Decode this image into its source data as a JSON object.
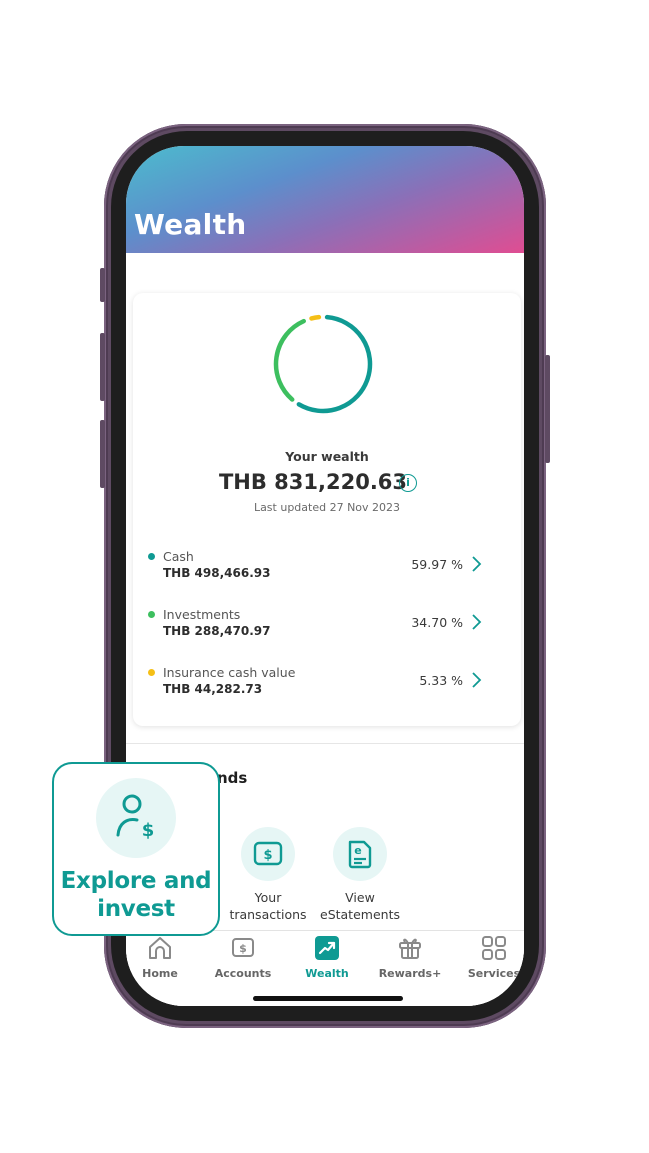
{
  "header": {
    "title": "Wealth"
  },
  "wealth": {
    "label": "Your wealth",
    "total": "THB 831,220.63",
    "info_icon": "info-icon",
    "last_updated": "Last updated 27 Nov 2023",
    "colors": {
      "cash": "#0f9a93",
      "investments": "#3dbf5f",
      "insurance": "#f5bf16"
    },
    "breakdown": [
      {
        "name": "Cash",
        "amount": "THB 498,466.93",
        "percent": "59.97 %",
        "share": 59.97,
        "color": "#0f9a93"
      },
      {
        "name": "Investments",
        "amount": "THB 288,470.97",
        "percent": "34.70 %",
        "share": 34.7,
        "color": "#3dbf5f"
      },
      {
        "name": "Insurance cash value",
        "amount": "THB 44,282.73",
        "percent": "5.33 %",
        "share": 5.33,
        "color": "#f5bf16"
      }
    ]
  },
  "section": {
    "title_visible": "nds"
  },
  "quick_actions": [
    {
      "label_line1": "Your",
      "label_line2": "transactions",
      "icon": "dollar-card-icon"
    },
    {
      "label_line1": "View",
      "label_line2": "eStatements",
      "icon": "estatement-icon"
    }
  ],
  "nav": [
    {
      "label": "Home",
      "icon": "home-icon",
      "active": false
    },
    {
      "label": "Accounts",
      "icon": "accounts-icon",
      "active": false
    },
    {
      "label": "Wealth",
      "icon": "wealth-chart-icon",
      "active": true
    },
    {
      "label": "Rewards+",
      "icon": "gift-icon",
      "active": false
    },
    {
      "label": "Services",
      "icon": "grid-icon",
      "active": false
    }
  ],
  "promo": {
    "line1": "Explore and",
    "line2": "invest",
    "icon": "user-dollar-icon",
    "accent": "#0f9a93"
  }
}
